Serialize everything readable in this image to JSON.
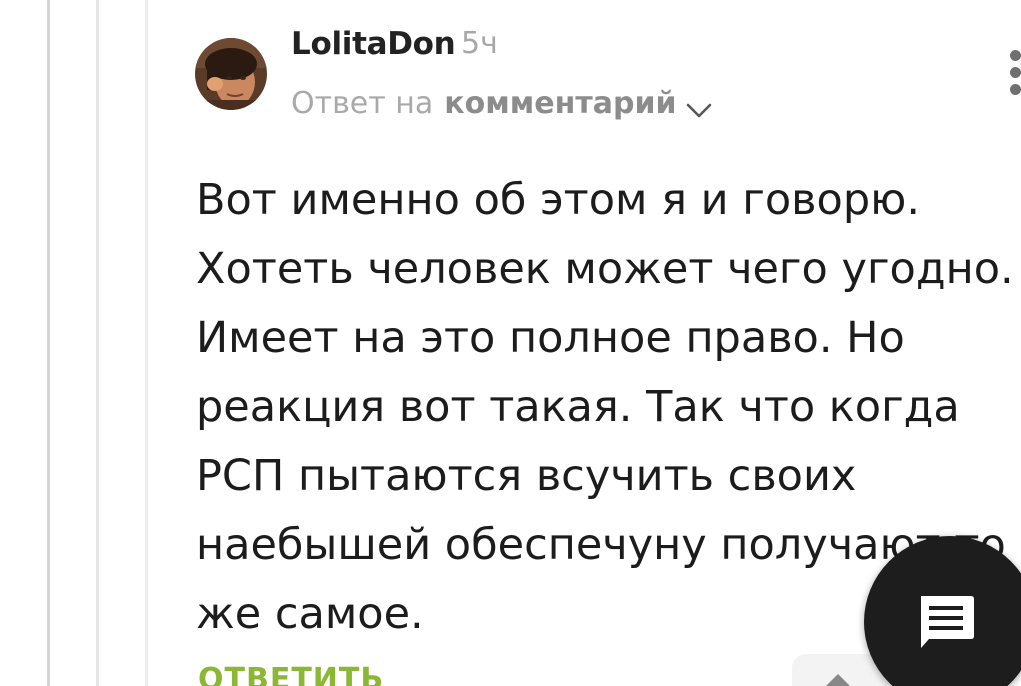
{
  "comment": {
    "author": "LolitaDon",
    "time_ago": "5ч",
    "reply_prefix": "Ответ на",
    "reply_target": "комментарий",
    "text": "Вот именно об этом я и говорю.\nХотеть человек может чего угодно.\nИмеет на это полное право. Но\nреакция вот такая. Так что когда\nРСП пытаются всучить своих\nнаебышей обеспечуну получают то\nже самое.",
    "reply_action_label": "ОТВЕТИТЬ"
  },
  "icons": {
    "avatar": "user-avatar",
    "reply_expand": "chevron-down-icon",
    "more": "more-vertical-icon",
    "fab": "comment-icon",
    "scroll": "chevron-up-icon"
  },
  "colors": {
    "accent_green": "#8ab834",
    "fab_background": "#1d1d1d",
    "muted_text": "#a9a9a9"
  }
}
